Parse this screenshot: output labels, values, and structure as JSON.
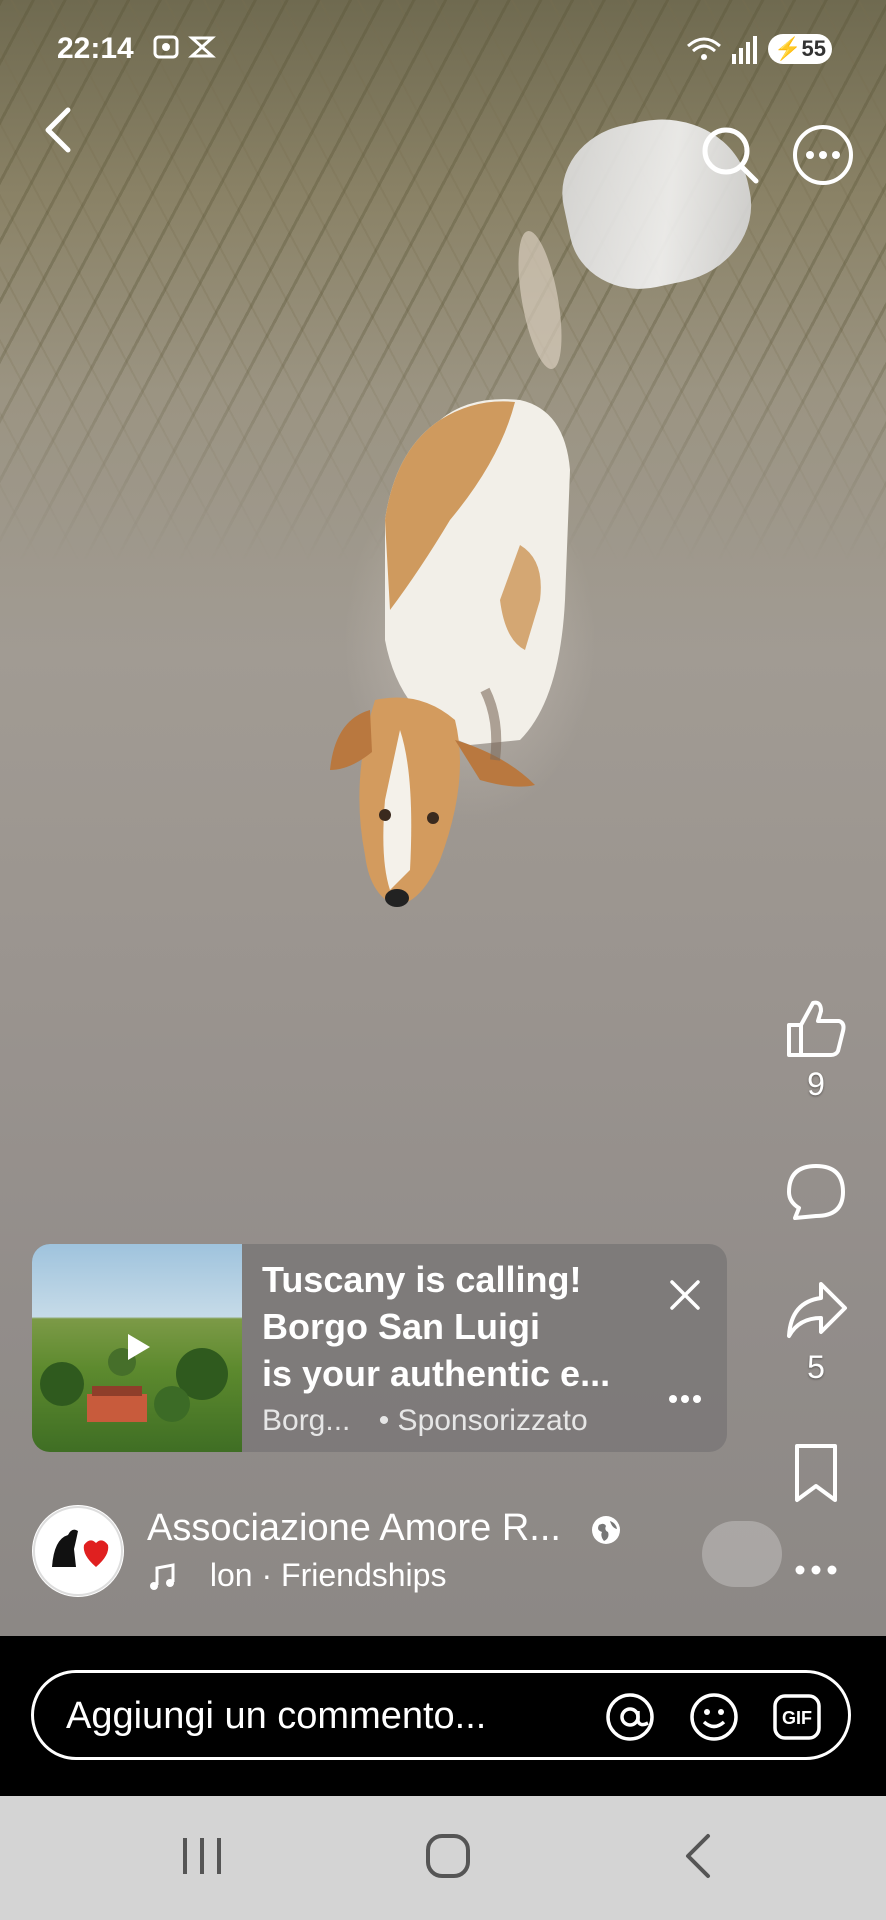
{
  "status_bar": {
    "time": "22:14",
    "battery": "55",
    "icons": [
      "screenshot-icon",
      "vpn-icon",
      "wifi-icon",
      "signal-icon",
      "battery-icon"
    ]
  },
  "top_actions": {
    "back_icon": "back-arrow-icon",
    "search_icon": "search-icon",
    "more_icon": "more-icon"
  },
  "side_actions": {
    "like_count": "9",
    "share_count": "5"
  },
  "ad": {
    "title": "Tuscany is calling! Borgo San Luigi is your authentic e...",
    "title_line1": "Tuscany is calling!",
    "title_line2": "Borgo San Luigi",
    "title_line3": "is your authentic e...",
    "advertiser": "Borg...",
    "sponsored": "• Sponsorizzato"
  },
  "author": {
    "name": "Associazione Amore R...",
    "music": "lon · Friendships"
  },
  "comment": {
    "placeholder": "Aggiungi un commento..."
  },
  "colors": {
    "accent_red": "#e02020",
    "nav_bg": "#d4d4d4"
  }
}
